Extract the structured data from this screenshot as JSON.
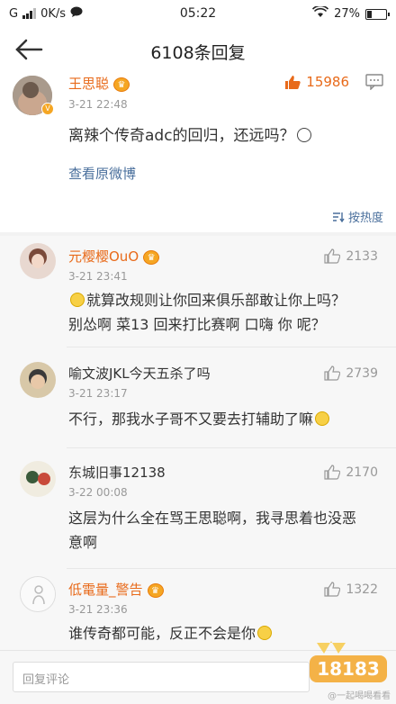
{
  "status": {
    "carrier_icon": "G",
    "speed": "0K/s",
    "time": "05:22",
    "battery": "27%",
    "battery_level": 0.27
  },
  "header": {
    "title": "6108条回复"
  },
  "main_post": {
    "username": "王思聪",
    "likes": "15986",
    "time": "3-21 22:48",
    "text": "离辣个传奇adc的回归，还远吗？",
    "link": "查看原微博",
    "sort_label": "按热度"
  },
  "replies": [
    {
      "username": "元樱樱OuO",
      "name_color": "orange",
      "vip": true,
      "time": "3-21 23:41",
      "likes": "2133",
      "lines": [
        "就算改规则让你回来俱乐部敢让你上吗？",
        "别怂啊 菜13 回来打比赛啊 口嗨 你 呢？"
      ]
    },
    {
      "username": "喻文波JKL今天五杀了吗",
      "name_color": "dark",
      "vip": false,
      "time": "3-21 23:17",
      "likes": "2739",
      "lines": [
        "不行，那我水子哥不又要去打辅助了嘛"
      ]
    },
    {
      "username": "东城旧事12138",
      "name_color": "dark",
      "vip": false,
      "time": "3-22 00:08",
      "likes": "2170",
      "lines": [
        "这层为什么全在骂王思聪啊，我寻思着也没恶",
        "意啊"
      ]
    },
    {
      "username": "低電量_警告",
      "name_color": "orange",
      "vip": true,
      "time": "3-21 23:36",
      "likes": "1322",
      "lines": [
        "谁传奇都可能，反正不会是你"
      ]
    }
  ],
  "input": {
    "placeholder": "回复评论"
  },
  "watermark": {
    "logo": "18183",
    "text": "@一起喝喝看看"
  },
  "colors": {
    "accent": "#e86a1a",
    "link": "#4a6f9c",
    "reply_bg": "#f7f7f7"
  }
}
